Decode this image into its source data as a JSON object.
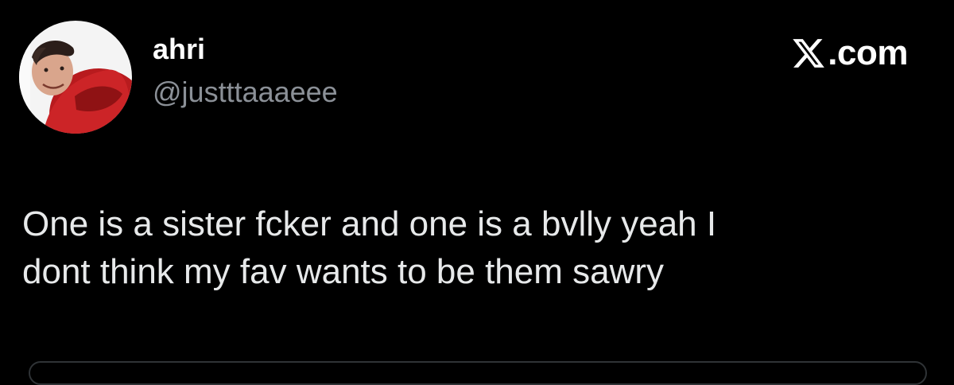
{
  "tweet": {
    "author": {
      "display_name": "ahri",
      "handle": "@justttaaaeee",
      "avatar": "profile-photo"
    },
    "brand": {
      "icon": "x-logo-icon",
      "text": ".com"
    },
    "text_lines": [
      "One is a sister fcker and one is a bvlly yeah I",
      "dont think my fav wants to be them sawry"
    ]
  },
  "colors": {
    "background": "#000000",
    "display_name": "#ffffff",
    "handle": "#8b9097",
    "body_text": "#e7e9ea",
    "card_border": "#2f3336"
  }
}
